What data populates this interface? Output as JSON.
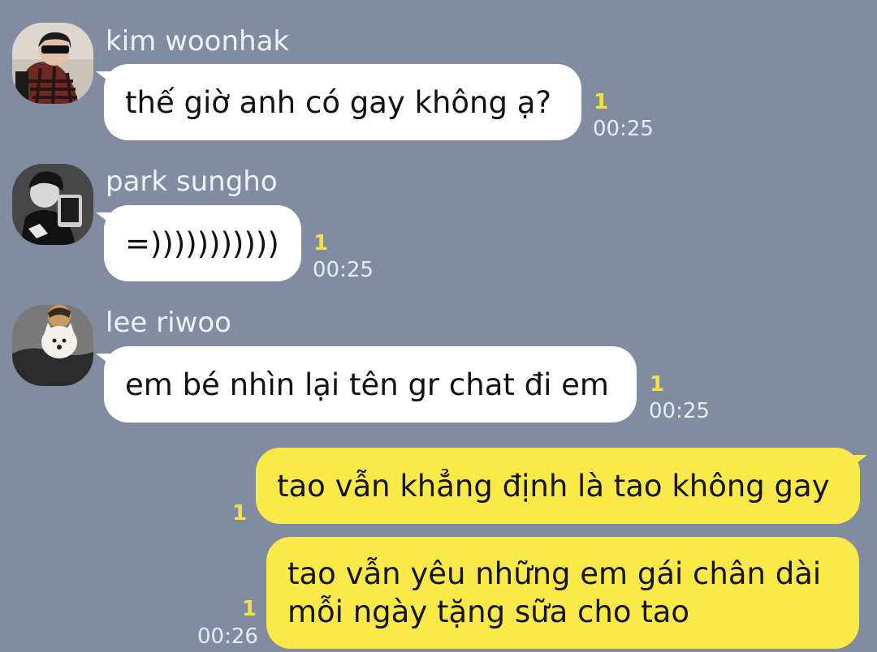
{
  "chat": {
    "messages": [
      {
        "id": "m1",
        "direction": "incoming",
        "sender": "kim woonhak",
        "avatar_icon": "profile-photo-kim-woonhak",
        "text": "thế giờ anh có gay không ạ?",
        "unread_count": "1",
        "time": "00:25"
      },
      {
        "id": "m2",
        "direction": "incoming",
        "sender": "park sungho",
        "avatar_icon": "profile-photo-park-sungho",
        "text": "=)))))))))))",
        "unread_count": "1",
        "time": "00:25"
      },
      {
        "id": "m3",
        "direction": "incoming",
        "sender": "lee riwoo",
        "avatar_icon": "profile-photo-lee-riwoo",
        "text": "em bé nhìn lại tên gr chat đi em",
        "unread_count": "1",
        "time": "00:25"
      },
      {
        "id": "m4",
        "direction": "outgoing",
        "text": "tao vẫn khẳng định là tao không gay",
        "unread_count": "1"
      },
      {
        "id": "m5",
        "direction": "outgoing",
        "text_lines": [
          "tao vẫn yêu những em gái chân dài",
          "mỗi ngày tặng sữa cho tao"
        ],
        "unread_count": "1",
        "time": "00:26"
      }
    ]
  },
  "colors": {
    "background": "#828ca0",
    "incoming_bubble": "#ffffff",
    "outgoing_bubble": "#fbe94a",
    "unread_badge": "#f7e13c",
    "timestamp": "#e8ebf1"
  }
}
